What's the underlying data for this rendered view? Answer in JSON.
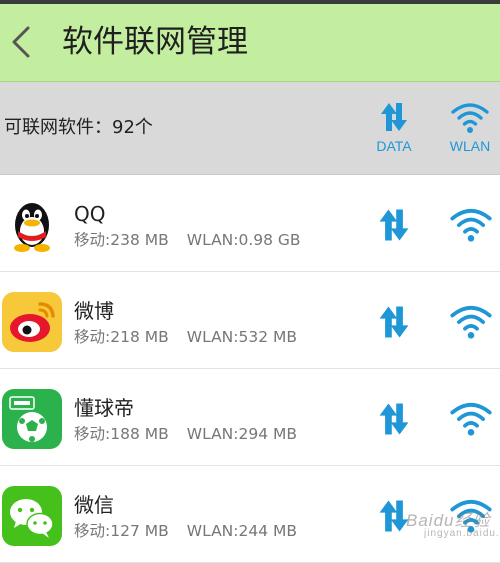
{
  "header": {
    "title": "软件联网管理",
    "background": "#c3ee9f"
  },
  "summary": {
    "text": "可联网软件：92个",
    "columns": [
      {
        "label": "DATA",
        "icon": "up-down-arrows-icon"
      },
      {
        "label": "WLAN",
        "icon": "wifi-icon"
      }
    ]
  },
  "apps": [
    {
      "name": "QQ",
      "mobile": "移动:238 MB",
      "wlan": "WLAN:0.98 GB",
      "icon": "qq-penguin-icon"
    },
    {
      "name": "微博",
      "mobile": "移动:218 MB",
      "wlan": "WLAN:532 MB",
      "icon": "weibo-icon"
    },
    {
      "name": "懂球帝",
      "mobile": "移动:188 MB",
      "wlan": "WLAN:294 MB",
      "icon": "dongqiudi-icon"
    },
    {
      "name": "微信",
      "mobile": "移动:127 MB",
      "wlan": "WLAN:244 MB",
      "icon": "wechat-icon"
    }
  ],
  "watermark": {
    "main": "Baidu经验",
    "sub": "jingyan.baidu.com"
  },
  "colors": {
    "accent": "#1f97d6",
    "summary_bg": "#d9d9d9"
  }
}
